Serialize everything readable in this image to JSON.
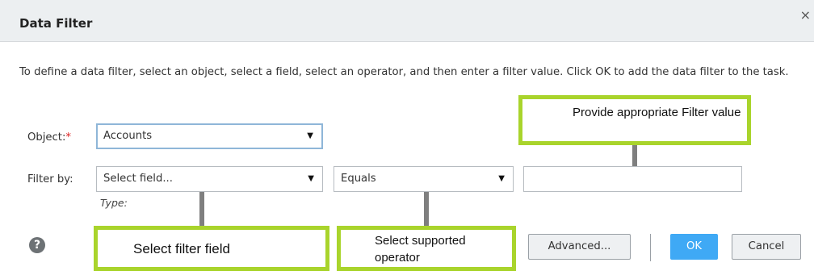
{
  "dialog": {
    "title": "Data Filter",
    "close_glyph": "×"
  },
  "description": "To define a data filter, select an object, select a field, select an operator, and then enter a filter value. Click OK to add the data filter to the task.",
  "object": {
    "label": "Object:",
    "required_mark": "*",
    "value": "Accounts"
  },
  "filter": {
    "label": "Filter by:",
    "field_value": "Select field...",
    "operator_value": "Equals",
    "value": "",
    "type_label": "Type:"
  },
  "dropdown_glyph": "▼",
  "callouts": {
    "value": "Provide appropriate Filter value",
    "field": "Select filter field",
    "operator": "Select supported operator"
  },
  "footer": {
    "help_glyph": "?",
    "advanced_label": "Advanced...",
    "ok_label": "OK",
    "cancel_label": "Cancel"
  },
  "colors": {
    "callout_border": "#a9d42c",
    "primary": "#3fa9f5",
    "header_bg": "#eceff1",
    "required": "#dd2222"
  },
  "icons": [
    "close-icon",
    "dropdown-arrow-icon",
    "help-icon"
  ]
}
